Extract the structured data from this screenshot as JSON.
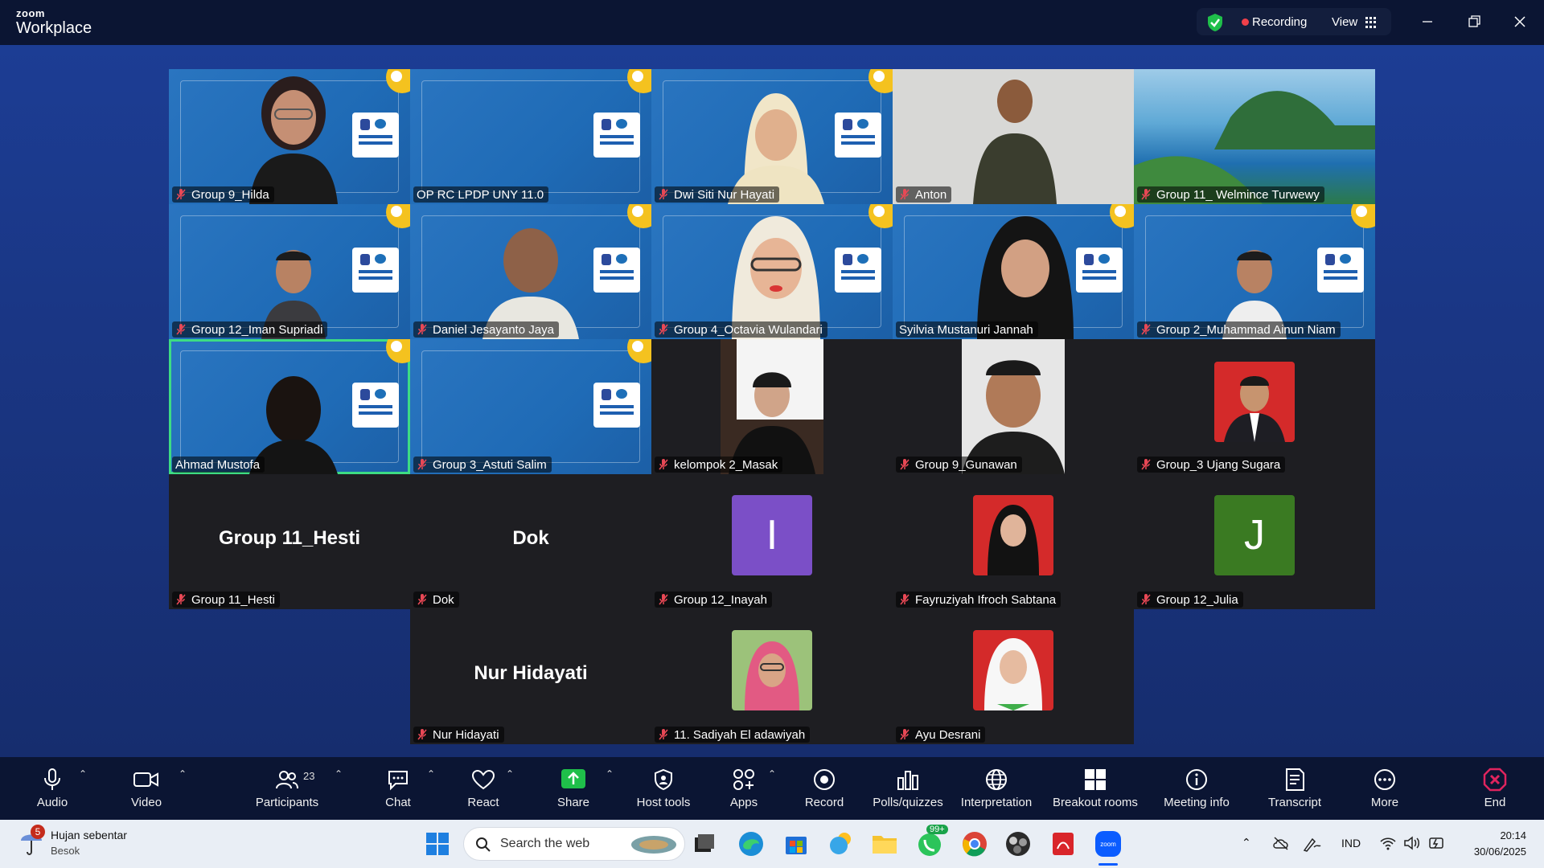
{
  "app": {
    "brand_small": "zoom",
    "brand_large": "Workplace"
  },
  "titlebar": {
    "recording_label": "Recording",
    "view_label": "View"
  },
  "participants": [
    {
      "name": "Group 9_Hilda",
      "type": "video-blue"
    },
    {
      "name": "OP RC LPDP UNY 11.0",
      "type": "video-blue",
      "muted": false
    },
    {
      "name": "Dwi Siti Nur Hayati",
      "type": "video-blue"
    },
    {
      "name": "Anton",
      "type": "video-room"
    },
    {
      "name": "Group  11_ Welmince Turwewy",
      "type": "video-island"
    },
    {
      "name": "Group 12_Iman Supriadi",
      "type": "video-blue"
    },
    {
      "name": "Daniel Jesayanto Jaya",
      "type": "video-blue"
    },
    {
      "name": "Group 4_Octavia Wulandari",
      "type": "video-blue"
    },
    {
      "name": "Syilvia Mustanuri Jannah",
      "type": "video-blue",
      "muted": false
    },
    {
      "name": "Group 2_Muhammad Ainun Niam",
      "type": "video-blue"
    },
    {
      "name": "Ahmad Mustofa",
      "type": "video-blue",
      "muted": false,
      "active_speaker": true
    },
    {
      "name": "Group 3_Astuti Salim",
      "type": "video-blue"
    },
    {
      "name": "kelompok 2_Masak",
      "type": "video-portrait"
    },
    {
      "name": "Group 9_Gunawan",
      "type": "video-portrait"
    },
    {
      "name": "Group_3 Ujang Sugara",
      "type": "photo"
    },
    {
      "name": "Group 11_Hesti",
      "type": "name-only",
      "display": "Group 11_Hesti"
    },
    {
      "name": "Dok",
      "type": "name-only",
      "display": "Dok"
    },
    {
      "name": "Group 12_Inayah",
      "type": "initial",
      "initial": "I",
      "color": "#7b4fc7"
    },
    {
      "name": "Fayruziyah Ifroch Sabtana",
      "type": "photo"
    },
    {
      "name": "Group 12_Julia",
      "type": "initial",
      "initial": "J",
      "color": "#3a7a22"
    },
    {
      "name": "Nur Hidayati",
      "type": "name-only",
      "display": "Nur Hidayati"
    },
    {
      "name": "11. Sadiyah El adawiyah",
      "type": "photo"
    },
    {
      "name": "Ayu Desrani",
      "type": "photo"
    }
  ],
  "toolbar": {
    "audio": "Audio",
    "video": "Video",
    "participants": "Participants",
    "participants_count": "23",
    "chat": "Chat",
    "react": "React",
    "share": "Share",
    "host_tools": "Host tools",
    "apps": "Apps",
    "record": "Record",
    "polls": "Polls/quizzes",
    "interpretation": "Interpretation",
    "breakout": "Breakout rooms",
    "meeting_info": "Meeting info",
    "transcript": "Transcript",
    "more": "More",
    "end": "End"
  },
  "taskbar": {
    "weather_title": "Hujan sebentar",
    "weather_sub": "Besok",
    "weather_badge": "5",
    "search_placeholder": "Search the web",
    "whatsapp_badge": "99+",
    "language": "IND",
    "time": "20:14",
    "date": "30/06/2025"
  },
  "colors": {
    "accent_green": "#3ddc84",
    "share_green": "#1fbf4a",
    "end_red": "#e0245e",
    "stage_blue": "#1c3d94"
  }
}
